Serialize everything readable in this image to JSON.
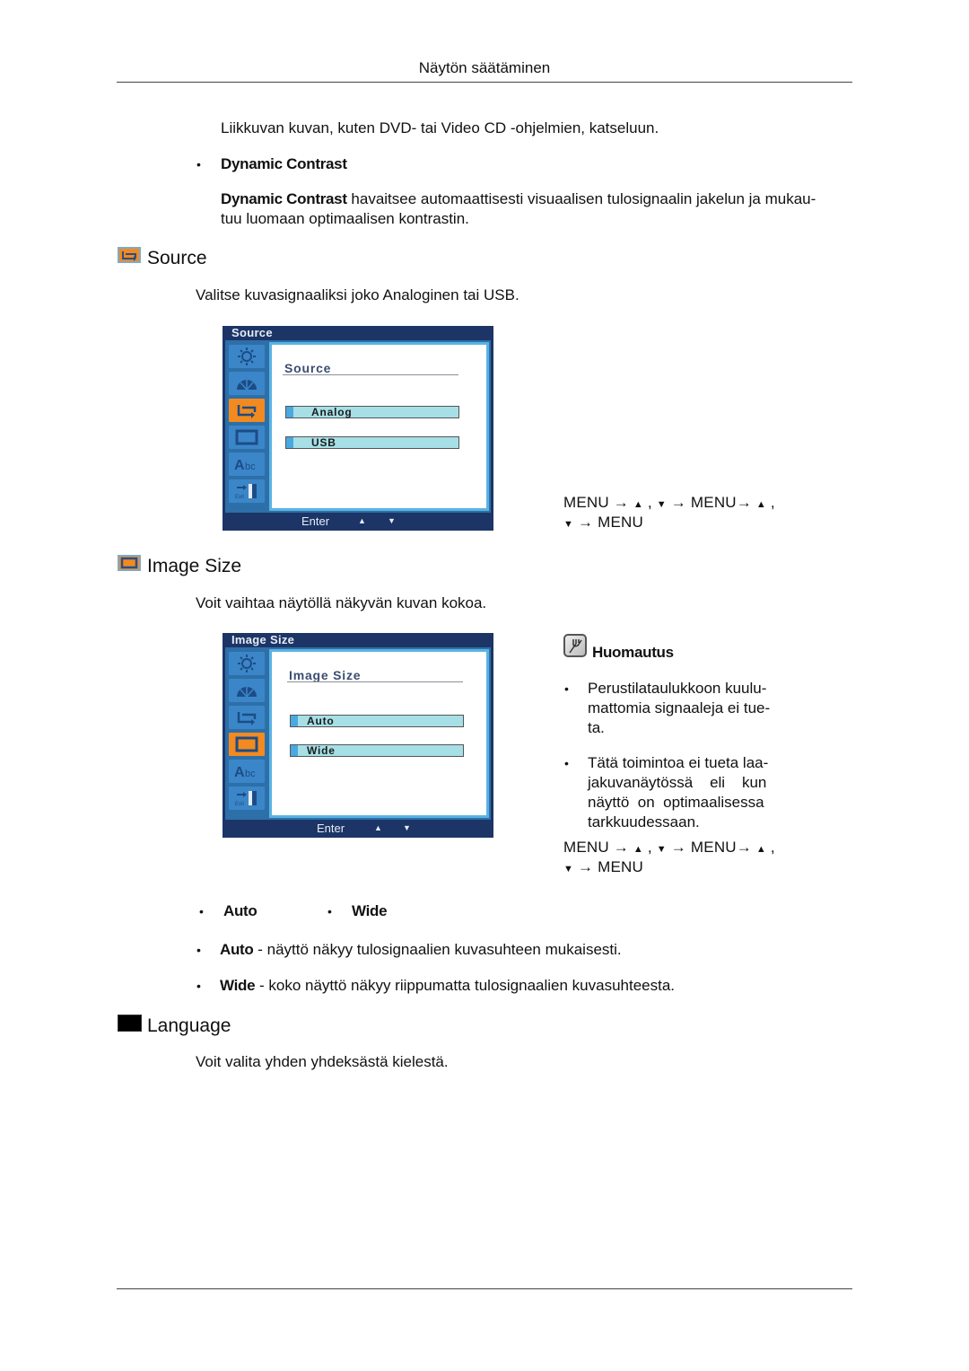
{
  "header": {
    "title": "Näytön säätäminen"
  },
  "intro": {
    "text": "Liikkuvan kuvan, kuten DVD- tai Video CD -ohjelmien, katseluun."
  },
  "dynamic_contrast": {
    "bullet_label": "Dynamic Contrast",
    "term": "Dynamic Contrast",
    "desc_line1": " havaitsee automaattisesti visuaalisen tulosignaalin jakelun ja mukau-",
    "desc_line2": "tuu luomaan optimaalisen kontrastin."
  },
  "source": {
    "title": "Source",
    "icon": "source-swap-icon",
    "description": "Valitse kuvasignaaliksi joko Analoginen tai USB.",
    "osd": {
      "window_title": "Source",
      "heading": "Source",
      "options": [
        "Analog",
        "USB"
      ],
      "footer_label": "Enter",
      "footer_up": "▲",
      "footer_down": "▼",
      "active_tab": "source"
    },
    "menu_seq": {
      "line1_a": "MENU → ",
      "line1_b": " , ",
      "line1_c": " → MENU→ ",
      "line1_d": " ,",
      "line2_a": " → MENU",
      "up": "▲",
      "down": "▼"
    }
  },
  "image_size": {
    "title": "Image Size",
    "icon": "image-size-icon",
    "description": "Voit vaihtaa näytöllä näkyvän kuvan kokoa.",
    "osd": {
      "window_title": "Image Size",
      "heading": "Image Size",
      "options": [
        "Auto",
        "Wide"
      ],
      "footer_label": "Enter",
      "footer_up": "▲",
      "footer_down": "▼",
      "active_tab": "image-size"
    },
    "note": {
      "title": "Huomautus",
      "items": [
        [
          "Perustilataulukkoon  kuulu-",
          "mattomia signaaleja ei tue-",
          "ta."
        ],
        [
          "Tätä toimintoa ei tueta laa-",
          "jakuvanäytössä    eli    kun",
          "näyttö  on  optimaalisessa",
          "tarkkuudessaan."
        ]
      ]
    },
    "menu_seq": {
      "line1_a": "MENU → ",
      "line1_b": " , ",
      "line1_c": " → MENU→ ",
      "line1_d": " ,",
      "line2_a": " → MENU",
      "up": "▲",
      "down": "▼"
    },
    "option_bullets": [
      "Auto",
      "Wide"
    ],
    "option_desc": [
      {
        "term": "Auto",
        "text": " - näyttö näkyy tulosignaalien kuvasuhteen mukaisesti."
      },
      {
        "term": "Wide",
        "text": " - koko näyttö näkyy riippumatta tulosignaalien kuvasuhteesta."
      }
    ]
  },
  "language": {
    "title": "Language",
    "icon": "language-icon",
    "description": "Voit valita yhden yhdeksästä kielestä."
  },
  "osd_sidebar_icons": [
    "brightness-icon",
    "color-gauge-icon",
    "source-swap-icon",
    "image-size-icon",
    "language-abc-icon",
    "exit-icon"
  ],
  "bullet_glyph": "•"
}
